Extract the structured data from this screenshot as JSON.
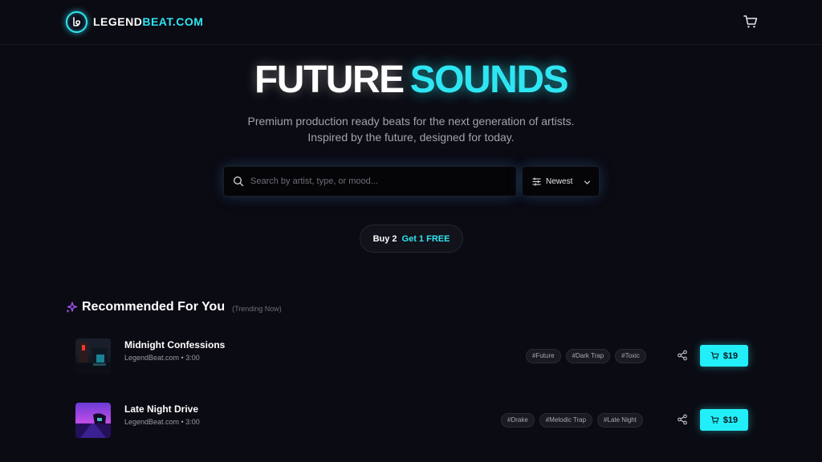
{
  "brand": {
    "name_part1": "LEGEND",
    "name_part2": "BEAT.COM"
  },
  "header": {
    "cart_icon": "cart-icon"
  },
  "hero": {
    "title_white": "FUTURE",
    "title_cyan": "SOUNDS",
    "subtitle": "Premium production ready beats for the next generation of artists. Inspired by the future, designed for today."
  },
  "search": {
    "placeholder": "Search by artist, type, or mood...",
    "value": ""
  },
  "sort": {
    "selected": "Newest"
  },
  "promo": {
    "part1": "Buy 2",
    "part2": "Get 1 FREE"
  },
  "recommended": {
    "title": "Recommended For You",
    "subtitle": "(Trending Now)",
    "beats": [
      {
        "title": "Midnight Confessions",
        "meta": "LegendBeat.com • 3:00",
        "tags": [
          "#Future",
          "#Dark Trap",
          "#Toxic"
        ],
        "price": "$19"
      },
      {
        "title": "Late Night Drive",
        "meta": "LegendBeat.com • 3:00",
        "tags": [
          "#Drake",
          "#Melodic Trap",
          "#Late Night"
        ],
        "price": "$19"
      }
    ]
  },
  "colors": {
    "accent": "#2ee6f2",
    "background": "#0b0b13",
    "sparkle": "#a855f7"
  }
}
